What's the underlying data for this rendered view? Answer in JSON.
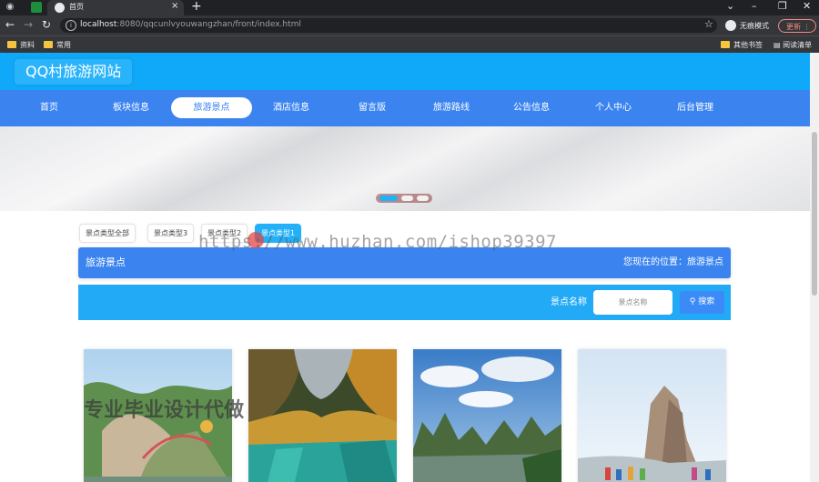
{
  "browser": {
    "tab_title": "首页",
    "new_tab_icon": "+",
    "url_host": "localhost",
    "url_rest": ":8080/qqcunlvyouwangzhan/front/index.html",
    "incognito_label": "无痕模式",
    "update_label": "更新",
    "bookmarks": [
      "资料",
      "常用"
    ],
    "bookmarks_right": [
      "其他书签",
      "阅读清单"
    ]
  },
  "site": {
    "logo": "QQ村旅游网站",
    "nav": [
      "首页",
      "板块信息",
      "旅游景点",
      "酒店信息",
      "留言版",
      "旅游路线",
      "公告信息",
      "个人中心",
      "后台管理"
    ],
    "active_nav_index": 2
  },
  "categories": [
    "景点类型全部",
    "景点类型3",
    "景点类型2",
    "景点类型1"
  ],
  "active_category_index": 3,
  "section": {
    "title": "旅游景点",
    "breadcrumb": "您现在的位置：旅游景点"
  },
  "search": {
    "label": "景点名称",
    "placeholder": "景点名称",
    "button": "搜索"
  },
  "cards": [
    {
      "scene": "mountain-bridge"
    },
    {
      "scene": "autumn-lake"
    },
    {
      "scene": "karst-river"
    },
    {
      "scene": "rock-peak-crowd"
    }
  ],
  "watermark": {
    "url_text": "https://www.huzhan.com/ishop39397",
    "cn_text": "专业毕业设计代做"
  },
  "colors": {
    "header": "#10a8f8",
    "navbar": "#3b84f0",
    "search_bar": "#22aaf6",
    "active_category": "#22b0f9"
  }
}
